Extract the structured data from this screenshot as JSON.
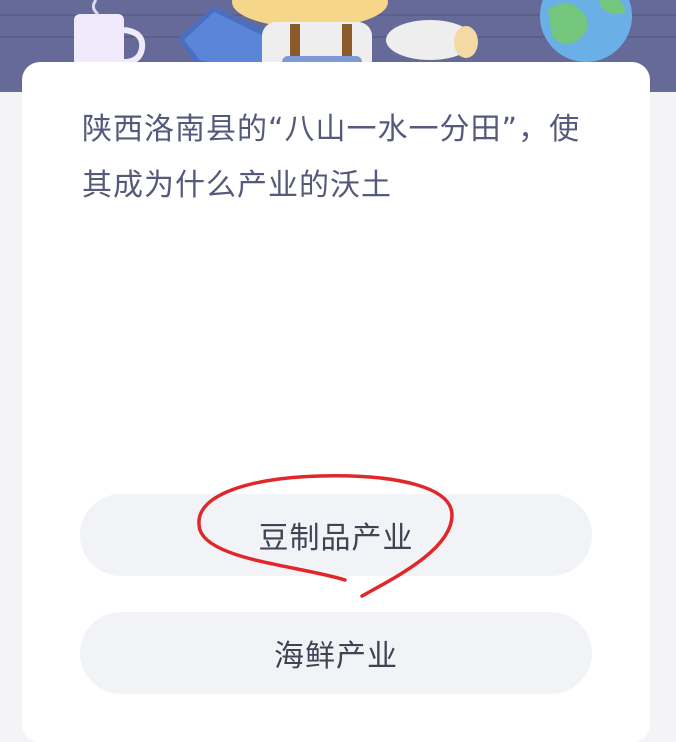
{
  "quiz": {
    "question": "陕西洛南县的“八山一水一分田”，使其成为什么产业的沃土",
    "options": [
      {
        "label": "豆制品产业",
        "circled": true
      },
      {
        "label": "海鲜产业",
        "circled": false
      }
    ]
  },
  "colors": {
    "header": "#666a98",
    "card": "#ffffff",
    "option_bg": "#f2f3f6",
    "question_text": "#55597a",
    "marker": "#e0282a"
  },
  "icons": [
    "mug-icon",
    "book-icon",
    "character-illustration",
    "globe-icon"
  ]
}
